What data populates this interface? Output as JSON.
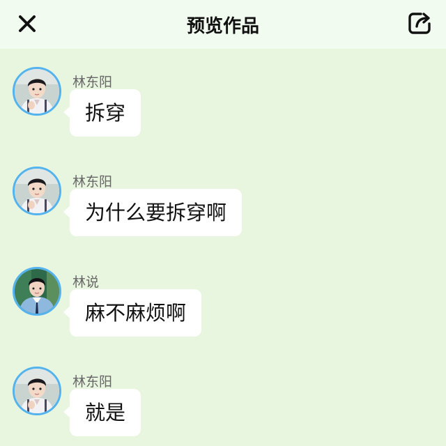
{
  "header": {
    "title": "预览作品",
    "close_icon": "close-icon",
    "share_icon": "share-icon"
  },
  "messages": [
    {
      "sender": "林东阳",
      "text": "拆穿",
      "avatar": "avatar-boy-white-shirt"
    },
    {
      "sender": "林东阳",
      "text": "为什么要拆穿啊",
      "avatar": "avatar-boy-white-shirt"
    },
    {
      "sender": "林说",
      "text": "麻不麻烦啊",
      "avatar": "avatar-boy-blue-uniform"
    },
    {
      "sender": "林东阳",
      "text": "就是",
      "avatar": "avatar-boy-white-shirt"
    }
  ],
  "colors": {
    "background": "#e8f5df",
    "header_background": "#f1fbef",
    "avatar_border": "#53b3ee",
    "bubble": "#ffffff"
  }
}
